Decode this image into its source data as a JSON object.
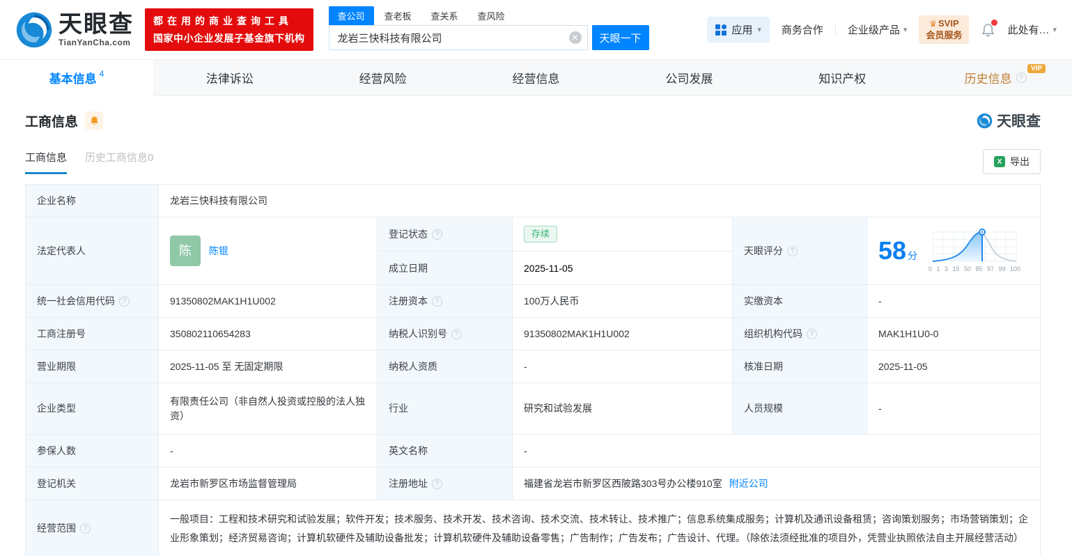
{
  "brand": {
    "name": "天眼查",
    "domain": "TianYanCha.com",
    "promo_line1": "都在用的商业查询工具",
    "promo_line2": "国家中小企业发展子基金旗下机构"
  },
  "search": {
    "tabs": [
      "查公司",
      "查老板",
      "查关系",
      "查风险"
    ],
    "value": "龙岩三快科技有限公司",
    "button": "天眼一下"
  },
  "topnav": {
    "apps": "应用",
    "biz": "商务合作",
    "enterprise": "企业级产品",
    "svip_line1": "SVIP",
    "svip_line2": "会员服务",
    "more": "此处有…"
  },
  "nav": {
    "items": [
      {
        "label": "基本信息",
        "badge": "4"
      },
      {
        "label": "法律诉讼"
      },
      {
        "label": "经营风险"
      },
      {
        "label": "经营信息"
      },
      {
        "label": "公司发展"
      },
      {
        "label": "知识产权"
      },
      {
        "label": "历史信息",
        "vip": "VIP"
      }
    ]
  },
  "section": {
    "title": "工商信息",
    "subtab_active": "工商信息",
    "subtab_history": "历史工商信息0",
    "export": "导出",
    "watermark": "天眼查"
  },
  "score_chart": {
    "type": "area",
    "score": "58",
    "unit": "分",
    "ticks": [
      "0",
      "1",
      "3",
      "15",
      "50",
      "85",
      "97",
      "99",
      "100"
    ]
  },
  "fields": {
    "company_name": {
      "label": "企业名称",
      "value": "龙岩三快科技有限公司"
    },
    "legal_rep": {
      "label": "法定代表人",
      "value": "陈锟",
      "avatar": "陈"
    },
    "status": {
      "label": "登记状态",
      "value": "存续"
    },
    "established": {
      "label": "成立日期",
      "value": "2025-11-05"
    },
    "score": {
      "label": "天眼评分"
    },
    "credit_code": {
      "label": "统一社会信用代码",
      "value": "91350802MAK1H1U002"
    },
    "reg_capital": {
      "label": "注册资本",
      "value": "100万人民币"
    },
    "paid_capital": {
      "label": "实缴资本",
      "value": "-"
    },
    "reg_number": {
      "label": "工商注册号",
      "value": "350802110654283"
    },
    "taxpayer_id": {
      "label": "纳税人识别号",
      "value": "91350802MAK1H1U002"
    },
    "org_code": {
      "label": "组织机构代码",
      "value": "MAK1H1U0-0"
    },
    "business_term": {
      "label": "营业期限",
      "value": "2025-11-05 至 无固定期限"
    },
    "taxpayer_quality": {
      "label": "纳税人资质",
      "value": "-"
    },
    "approval_date": {
      "label": "核准日期",
      "value": "2025-11-05"
    },
    "company_type": {
      "label": "企业类型",
      "value": "有限责任公司（非自然人投资或控股的法人独资）"
    },
    "industry": {
      "label": "行业",
      "value": "研究和试验发展"
    },
    "staff_size": {
      "label": "人员规模",
      "value": "-"
    },
    "insured_count": {
      "label": "参保人数",
      "value": "-"
    },
    "english_name": {
      "label": "英文名称",
      "value": "-"
    },
    "reg_authority": {
      "label": "登记机关",
      "value": "龙岩市新罗区市场监督管理局"
    },
    "reg_address": {
      "label": "注册地址",
      "value": "福建省龙岩市新罗区西陂路303号办公楼910室",
      "link": "附近公司"
    },
    "business_scope": {
      "label": "经营范围",
      "value": "一般项目：工程和技术研究和试验发展；软件开发；技术服务、技术开发、技术咨询、技术交流、技术转让、技术推广；信息系统集成服务；计算机及通讯设备租赁；咨询策划服务；市场营销策划；企业形象策划；经济贸易咨询；计算机软硬件及辅助设备批发；计算机软硬件及辅助设备零售；广告制作；广告发布；广告设计、代理。（除依法须经批准的项目外，凭营业执照依法自主开展经营活动）"
    }
  }
}
